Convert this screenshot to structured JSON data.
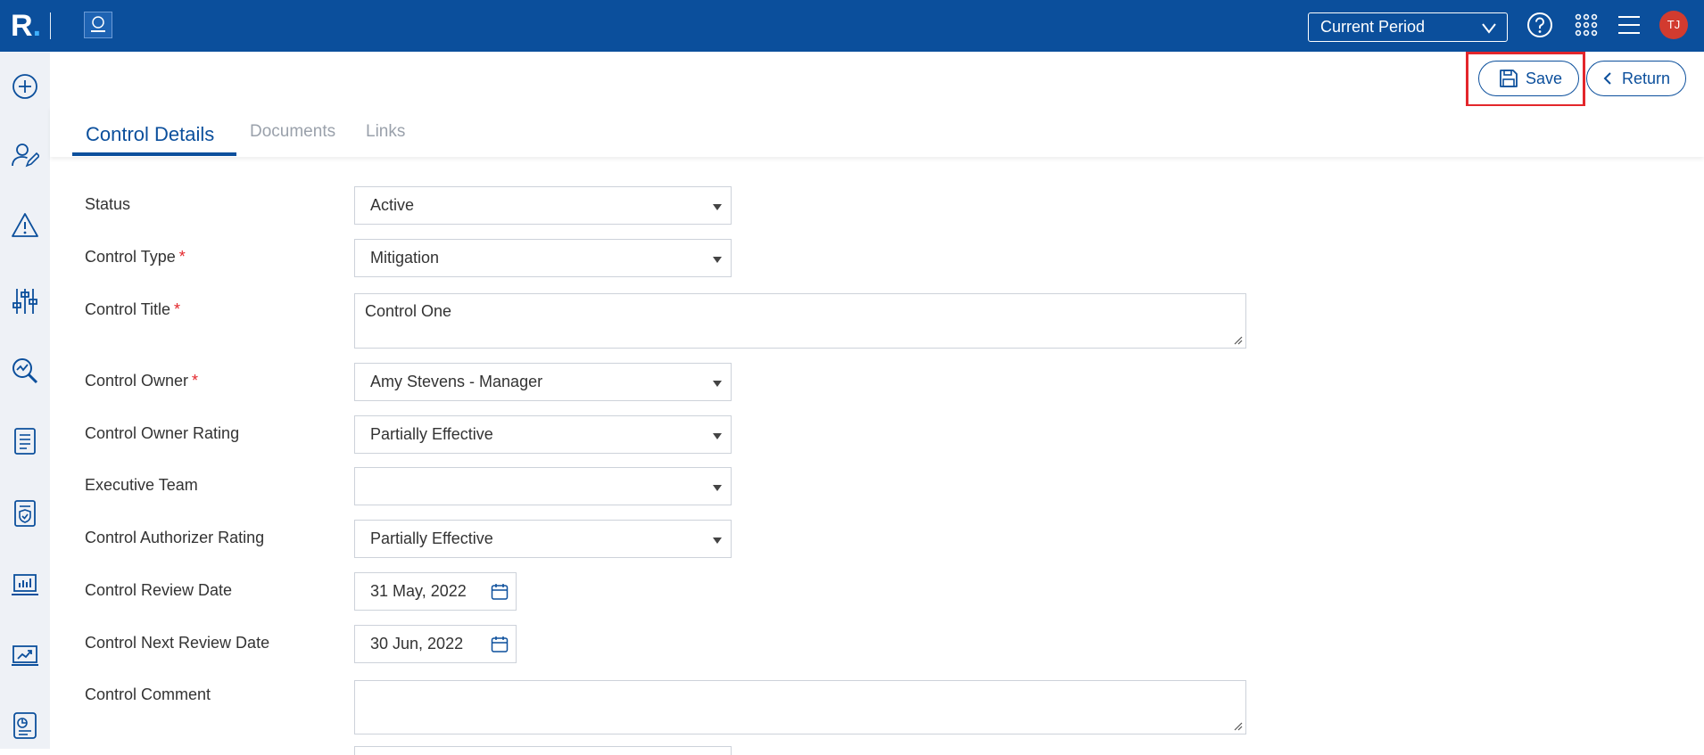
{
  "app": {
    "brand_letter": "R",
    "brand_dot": ".",
    "client_logo": "client-logo",
    "period_selector": "Current Period",
    "user_initials": "TJ",
    "colors": {
      "primary": "#0b4f9c",
      "highlight": "#e3262b",
      "required": "#e3262b",
      "avatar": "#d23b2f"
    }
  },
  "sidebar": {
    "icons": [
      "add-circle-icon",
      "user-edit-icon",
      "warning-icon",
      "sliders-icon",
      "magnify-chart-icon",
      "document-list-icon",
      "shield-document-icon",
      "laptop-chart-icon",
      "trend-chart-icon",
      "report-icon"
    ]
  },
  "actions": {
    "save_label": "Save",
    "return_label": "Return"
  },
  "tabs": [
    {
      "label": "Control Details",
      "active": true
    },
    {
      "label": "Documents",
      "active": false
    },
    {
      "label": "Links",
      "active": false
    }
  ],
  "form": {
    "status": {
      "label": "Status",
      "value": "Active"
    },
    "control_type": {
      "label": "Control Type",
      "required": "*",
      "value": "Mitigation"
    },
    "control_title": {
      "label": "Control Title",
      "required": "*",
      "value": "Control One"
    },
    "control_owner": {
      "label": "Control Owner",
      "required": "*",
      "value": "Amy Stevens - Manager"
    },
    "control_owner_rating": {
      "label": "Control Owner Rating",
      "value": "Partially Effective"
    },
    "executive_team": {
      "label": "Executive Team",
      "value": ""
    },
    "control_authorizer_rating": {
      "label": "Control Authorizer Rating",
      "value": "Partially Effective"
    },
    "control_review_date": {
      "label": "Control Review Date",
      "value": "31 May, 2022"
    },
    "control_next_review_date": {
      "label": "Control Next Review Date",
      "value": "30 Jun, 2022"
    },
    "control_comment": {
      "label": "Control Comment",
      "value": ""
    }
  }
}
